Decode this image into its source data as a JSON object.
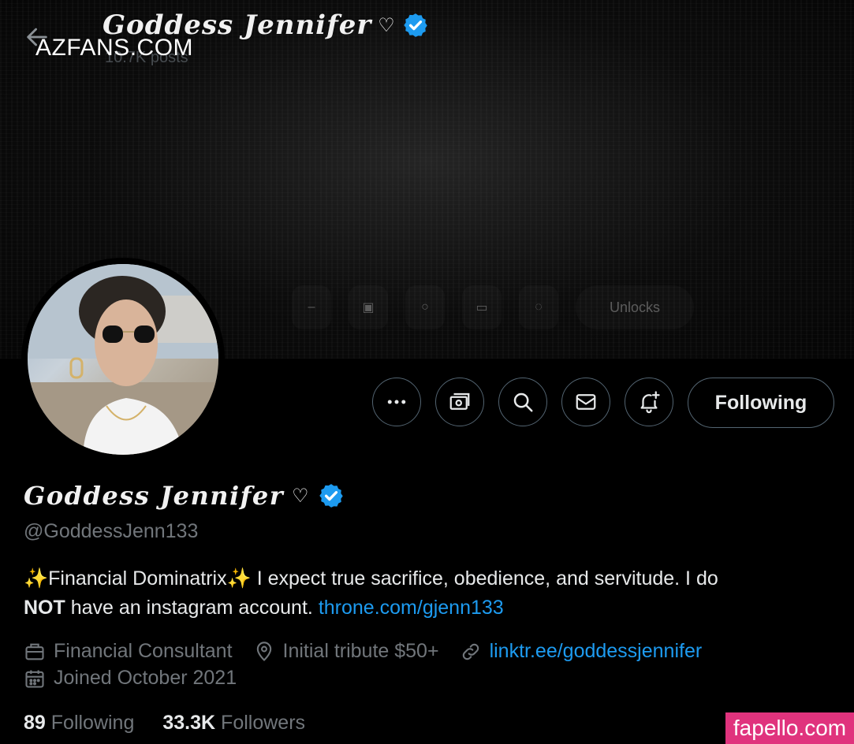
{
  "header": {
    "name": "Goddess Jennifer",
    "heart": "♡",
    "subtitle": "10.7K posts"
  },
  "watermarks": {
    "left": "AZFANS.COM",
    "right": "fapello.com"
  },
  "banner": {
    "ghost_text": "Unlocks"
  },
  "actions": {
    "following_label": "Following"
  },
  "profile": {
    "display_name": "Goddess Jennifer",
    "heart": "♡",
    "handle": "@GoddessJenn133",
    "bio": {
      "sparkle": "✨",
      "part1": "Financial Dominatrix",
      "part2": " I expect true sacrifice, obedience, and servitude. I do",
      "bold": "NOT",
      "part3": " have an instagram account. ",
      "link": "throne.com/gjenn133"
    },
    "category": "Financial Consultant",
    "location": "Initial tribute $50+",
    "website": "linktr.ee/goddessjennifer",
    "joined": "Joined October 2021"
  },
  "stats": {
    "following_count": "89",
    "following_label": "Following",
    "followers_count": "33.3K",
    "followers_label": "Followers"
  },
  "colors": {
    "accent": "#1d9bf0",
    "verified": "#1d9bf0",
    "muted": "#71767b",
    "watermark_pink": "#e0337d"
  },
  "icons": {
    "back": "arrow-left-icon",
    "more": "more-dots-icon",
    "tip": "money-icon",
    "search": "search-icon",
    "message": "envelope-icon",
    "notify": "bell-plus-icon",
    "category": "briefcase-icon",
    "location": "location-pin-icon",
    "website": "link-icon",
    "joined": "calendar-icon"
  }
}
